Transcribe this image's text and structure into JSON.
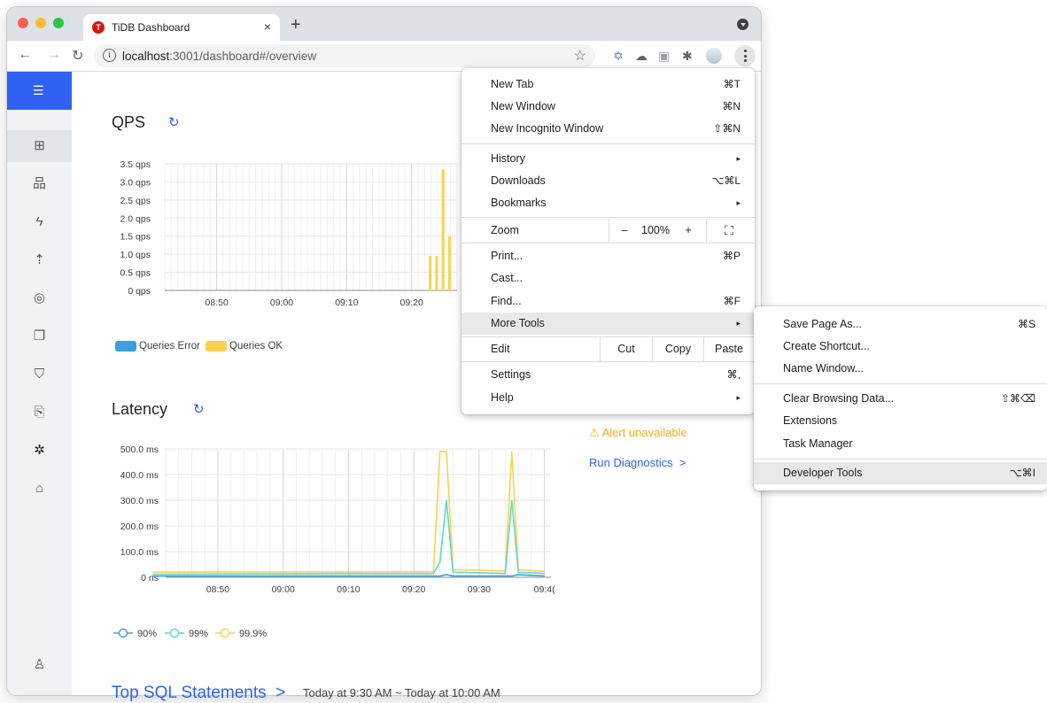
{
  "browser": {
    "tab_title": "TiDB Dashboard",
    "url_host": "localhost",
    "url_rest": ":3001/dashboard#/overview",
    "new_tab_symbol": "+",
    "close_symbol": "×"
  },
  "sections": {
    "qps_title": "QPS",
    "latency_title": "Latency",
    "top_sql_title": "Top SQL Statements",
    "top_sql_arrow": ">",
    "top_sql_range": "Today at 9:30 AM ~ Today at 10:00 AM"
  },
  "side_panel": {
    "alert": "Alert unavailable",
    "run_diagnostics": "Run Diagnostics",
    "arrow": ">"
  },
  "qps_chart": {
    "y_ticks": [
      "3.5 qps",
      "3.0 qps",
      "2.5 qps",
      "2.0 qps",
      "1.5 qps",
      "1.0 qps",
      "0.5 qps",
      "0 qps"
    ],
    "x_ticks": [
      "08:50",
      "09:00",
      "09:10",
      "09:20"
    ],
    "legend": [
      "Queries Error",
      "Queries OK"
    ],
    "colors": {
      "error": "#3b9fdf",
      "ok": "#fad24f"
    }
  },
  "latency_chart": {
    "y_ticks": [
      "500.0 ms",
      "400.0 ms",
      "300.0 ms",
      "200.0 ms",
      "100.0 ms",
      "0 ns"
    ],
    "x_ticks": [
      "08:50",
      "09:00",
      "09:10",
      "09:20",
      "09:30",
      "09:4("
    ],
    "legend": [
      "90%",
      "99%",
      "99.9%"
    ],
    "colors": {
      "p90": "#3b9fdf",
      "p99": "#5fd8cf",
      "p999": "#fad24f"
    }
  },
  "chart_data": [
    {
      "type": "bar",
      "title": "QPS",
      "xlabel": "",
      "ylabel": "",
      "ylim": [
        0,
        3.5
      ],
      "x": [
        "09:23",
        "09:24",
        "09:25",
        "09:26"
      ],
      "series": [
        {
          "name": "Queries Error",
          "values": [
            0,
            0,
            0,
            0
          ]
        },
        {
          "name": "Queries OK",
          "values": [
            0.95,
            0.95,
            3.35,
            1.5
          ]
        }
      ],
      "legend": "bottom-left",
      "grid": true
    },
    {
      "type": "line",
      "title": "Latency",
      "xlabel": "",
      "ylabel": "",
      "ylim": [
        0,
        500
      ],
      "x_range": [
        "08:40",
        "09:40"
      ],
      "series": [
        {
          "name": "90%",
          "points": [
            [
              "08:40",
              5
            ],
            [
              "09:24",
              5
            ],
            [
              "09:25",
              10
            ],
            [
              "09:26",
              5
            ],
            [
              "09:35",
              5
            ],
            [
              "09:36",
              10
            ],
            [
              "09:40",
              5
            ]
          ]
        },
        {
          "name": "99%",
          "points": [
            [
              "08:40",
              12
            ],
            [
              "09:23",
              15
            ],
            [
              "09:24",
              60
            ],
            [
              "09:25",
              300
            ],
            [
              "09:26",
              20
            ],
            [
              "09:34",
              15
            ],
            [
              "09:35",
              300
            ],
            [
              "09:36",
              20
            ],
            [
              "09:40",
              15
            ]
          ]
        },
        {
          "name": "99.9%",
          "points": [
            [
              "08:40",
              20
            ],
            [
              "09:23",
              22
            ],
            [
              "09:24",
              490
            ],
            [
              "09:25",
              490
            ],
            [
              "09:26",
              30
            ],
            [
              "09:34",
              25
            ],
            [
              "09:35",
              490
            ],
            [
              "09:36",
              30
            ],
            [
              "09:40",
              22
            ]
          ]
        }
      ],
      "legend": "bottom-left",
      "grid": true
    }
  ],
  "menu": {
    "new_tab": {
      "label": "New Tab",
      "shortcut": "⌘T"
    },
    "new_window": {
      "label": "New Window",
      "shortcut": "⌘N"
    },
    "new_incognito": {
      "label": "New Incognito Window",
      "shortcut": "⇧⌘N"
    },
    "history": {
      "label": "History",
      "arrow": "▸"
    },
    "downloads": {
      "label": "Downloads",
      "shortcut": "⌥⌘L"
    },
    "bookmarks": {
      "label": "Bookmarks",
      "arrow": "▸"
    },
    "zoom": {
      "label": "Zoom",
      "minus": "–",
      "value": "100%",
      "plus": "+"
    },
    "print": {
      "label": "Print...",
      "shortcut": "⌘P"
    },
    "cast": {
      "label": "Cast..."
    },
    "find": {
      "label": "Find...",
      "shortcut": "⌘F"
    },
    "more_tools": {
      "label": "More Tools",
      "arrow": "▸"
    },
    "edit": {
      "label": "Edit",
      "cut": "Cut",
      "copy": "Copy",
      "paste": "Paste"
    },
    "settings": {
      "label": "Settings",
      "shortcut": "⌘,"
    },
    "help": {
      "label": "Help",
      "arrow": "▸"
    }
  },
  "submenu": {
    "save_page": {
      "label": "Save Page As...",
      "shortcut": "⌘S"
    },
    "create_shortcut": {
      "label": "Create Shortcut..."
    },
    "name_window": {
      "label": "Name Window..."
    },
    "clear_data": {
      "label": "Clear Browsing Data...",
      "shortcut": "⇧⌘⌫"
    },
    "extensions": {
      "label": "Extensions"
    },
    "task_manager": {
      "label": "Task Manager"
    },
    "developer_tools": {
      "label": "Developer Tools",
      "shortcut": "⌥⌘I"
    }
  }
}
